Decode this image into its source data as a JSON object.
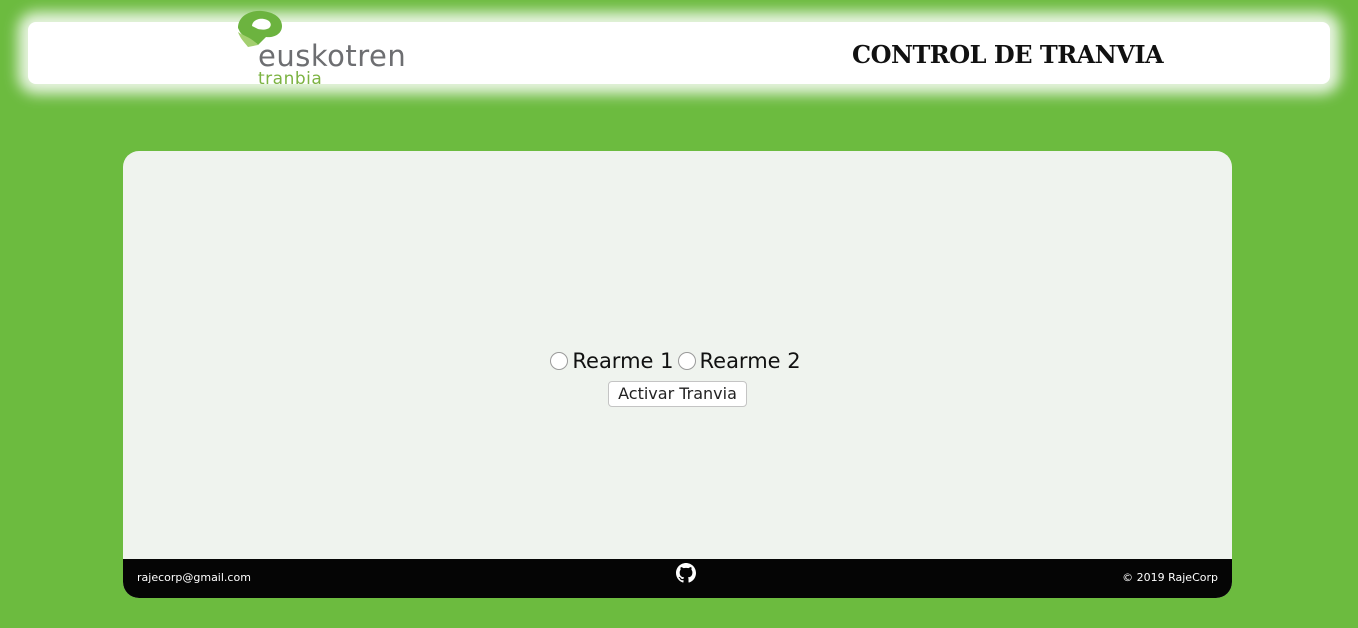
{
  "header": {
    "logo": {
      "word": "euskotren",
      "sub": "tranbia",
      "icon": "euskotren-logo-mark",
      "mark_color_dark": "#6cb33f",
      "mark_color_light": "#a3cf6f"
    },
    "title": "CONTROL DE TRANVIA"
  },
  "main": {
    "radios": [
      {
        "label": "Rearme 1",
        "checked": false
      },
      {
        "label": "Rearme 2",
        "checked": false
      }
    ],
    "activate_button_label": "Activar Tranvia"
  },
  "footer": {
    "email": "rajecorp@gmail.com",
    "github_icon": "github-icon",
    "copyright": "© 2019 RajeCorp"
  },
  "colors": {
    "background": "#6cbb3f",
    "card": "#eff3ee",
    "footer": "#050505"
  }
}
